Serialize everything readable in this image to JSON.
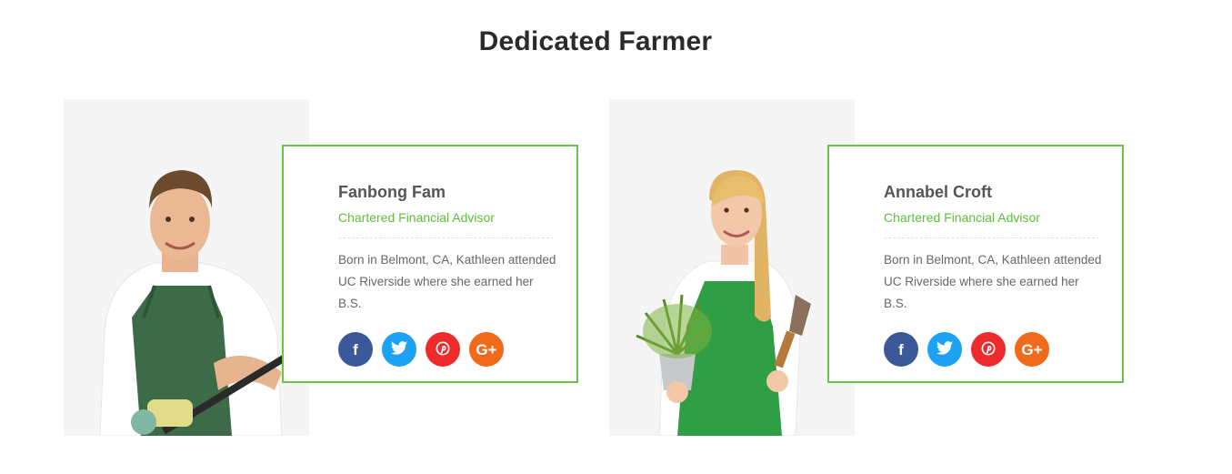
{
  "section": {
    "title": "Dedicated Farmer"
  },
  "members": [
    {
      "name": "Fanbong Fam",
      "role": "Chartered Financial Advisor",
      "bio": "Born in Belmont, CA, Kathleen attended UC Riverside where she earned her B.S."
    },
    {
      "name": "Annabel Croft",
      "role": "Chartered Financial Advisor",
      "bio": "Born in Belmont, CA, Kathleen attended UC Riverside where she earned her B.S."
    }
  ],
  "socials": {
    "facebook": {
      "glyph": "f",
      "color": "#3b5998",
      "icon": "facebook-icon"
    },
    "twitter": {
      "glyph": "t",
      "color": "#1da1f2",
      "icon": "twitter-icon"
    },
    "pinterest": {
      "glyph": "p",
      "color": "#ee2b2b",
      "icon": "pinterest-icon"
    },
    "googleplus": {
      "glyph": "G+",
      "color": "#f06a1b",
      "icon": "google-plus-icon"
    }
  },
  "colors": {
    "accent": "#6cc24a",
    "role_text": "#5bbf3a",
    "photo_bg": "#f6f5f6"
  }
}
